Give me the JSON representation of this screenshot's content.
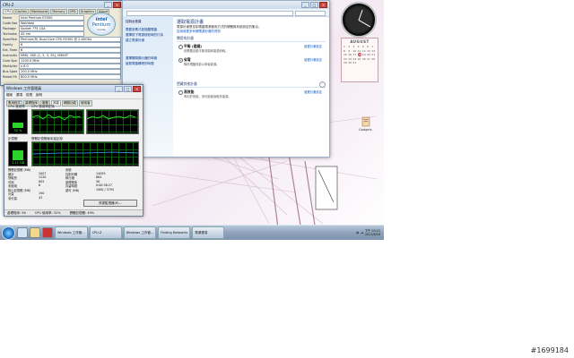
{
  "cpuz": {
    "title": "CPU-Z",
    "tabs": [
      "CPU",
      "Caches",
      "Mainboard",
      "Memory",
      "SPD",
      "Graphics",
      "About"
    ],
    "rows": [
      {
        "label": "Name",
        "value": "Intel Pentium E5300"
      },
      {
        "label": "Code Name",
        "value": "Wolfdale"
      },
      {
        "label": "Package",
        "value": "Socket 775 LGA"
      },
      {
        "label": "Technology",
        "value": "45 nm"
      },
      {
        "label": "Specification",
        "value": "Pentium(R) Dual-Core CPU E5300 @ 2.60GHz"
      },
      {
        "label": "Family",
        "value": "6"
      },
      {
        "label": "Ext. Family",
        "value": "6"
      },
      {
        "label": "Instructions",
        "value": "MMX, SSE (1, 2, 3, 3S), EM64T"
      },
      {
        "label": "Core Speed",
        "value": "1200.0 MHz"
      },
      {
        "label": "Multiplier",
        "value": "x 6.0"
      },
      {
        "label": "Bus Speed",
        "value": "200.0 MHz"
      },
      {
        "label": "Rated FSB",
        "value": "800.0 MHz"
      }
    ],
    "logo": {
      "brand": "intel",
      "product": "Pentium",
      "tag": "inside"
    }
  },
  "taskmgr": {
    "title": "Windows 工作管理員",
    "menu": [
      "檔案",
      "選項",
      "檢視",
      "說明"
    ],
    "tabs": [
      "應用程式",
      "處理程序",
      "服務",
      "效能",
      "網路功能",
      "使用者"
    ],
    "cpu_label": "CPU 使用率",
    "cpu_hist_label": "CPU 使用率記錄",
    "mem_label": "記憶體",
    "mem_hist_label": "實體記憶體使用量記錄",
    "cpu_value": "32 %",
    "mem_value": "1.17 GB",
    "cpu_fraction": 0.32,
    "mem_fraction": 0.6,
    "stats_left": [
      {
        "k": "實體記憶體 (MB)",
        "v": ""
      },
      {
        "k": "總計",
        "v": "2007"
      },
      {
        "k": "快取的",
        "v": "1220"
      },
      {
        "k": "可用",
        "v": "805"
      },
      {
        "k": "未使用",
        "v": "6"
      },
      {
        "k": "核心記憶體 (MB)",
        "v": ""
      },
      {
        "k": "分頁",
        "v": "190"
      },
      {
        "k": "非分頁",
        "v": "43"
      }
    ],
    "stats_right": [
      {
        "k": "系統",
        "v": ""
      },
      {
        "k": "控制代碼",
        "v": "14059"
      },
      {
        "k": "執行緒",
        "v": "664"
      },
      {
        "k": "處理程序",
        "v": "56"
      },
      {
        "k": "存留時間",
        "v": "0:00:36:27"
      },
      {
        "k": "認可 (MB)",
        "v": "1900 / 3795"
      }
    ],
    "resmon_button": "資源監視器(R)...",
    "status": [
      "處理程序: 56",
      "CPU 使用率: 32%",
      "實體記憶體: 49%"
    ]
  },
  "control_panel": {
    "left_links": [
      "控制台首頁",
      "需要密碼才能喚醒電腦",
      "選擇按下電源按鈕時的行為",
      "建立電源計畫",
      "選擇關閉顯示器的時機",
      "變更電腦睡眠的時間"
    ],
    "heading": "選取電源計畫",
    "intro": "電源計畫是控制電腦電源使用方式的硬體與系統設定的集合。",
    "intro_link": "告訴我更多有關電源計畫的資訊",
    "section_preferred": "慣用的計畫",
    "plans": [
      {
        "name": "平衡 (建議)",
        "desc": "依需要自動平衡效能和能源消耗。",
        "change": "變更計畫設定",
        "selected": false
      },
      {
        "name": "省電",
        "desc": "降低電腦效能以節省能源。",
        "change": "變更計畫設定",
        "selected": true
      }
    ],
    "section_extra": "隱藏其他計畫",
    "extra_plans": [
      {
        "name": "高效能",
        "desc": "有利於效能，但可能使用較多能源。",
        "change": "變更計畫設定",
        "selected": false
      }
    ]
  },
  "gadgets": {
    "calendar_month": "AUGUST",
    "calendar_days": [
      "1",
      "2",
      "3",
      "4",
      "5",
      "6",
      "7",
      "8",
      "9",
      "10",
      "11",
      "12",
      "13",
      "14",
      "15",
      "16",
      "17",
      "18",
      "19",
      "20",
      "21",
      "22",
      "23",
      "24",
      "25",
      "26",
      "27",
      "28",
      "29",
      "30",
      "31"
    ],
    "today": "18",
    "icon_label": "Gadgets"
  },
  "taskbar": {
    "tasks": [
      "Windows 工作管...",
      "CPU-Z",
      "Windows 工作管...",
      "Finding Networks",
      "電源選項"
    ],
    "time": "下午 03:22",
    "date": "2011/8/18"
  },
  "watermark": "#1699184",
  "colors": {
    "accent": "#1e3c78",
    "link": "#0b56c8",
    "meter": "#2bd32b",
    "taskbar": "#8ea3bb"
  }
}
